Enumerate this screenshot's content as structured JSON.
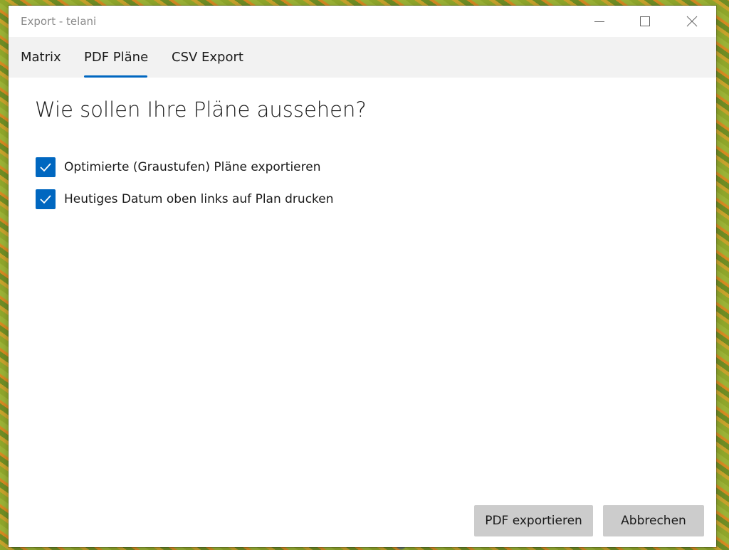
{
  "window": {
    "title": "Export - telani",
    "controls": {
      "minimize_icon": "minimize-icon",
      "maximize_icon": "maximize-icon",
      "close_icon": "close-icon"
    }
  },
  "tabs": [
    {
      "label": "Matrix",
      "selected": false
    },
    {
      "label": "PDF Pläne",
      "selected": true
    },
    {
      "label": "CSV Export",
      "selected": false
    }
  ],
  "main": {
    "heading": "Wie sollen Ihre Pläne aussehen?",
    "options": [
      {
        "label": "Optimierte (Graustufen) Pläne exportieren",
        "checked": true
      },
      {
        "label": "Heutiges Datum oben links auf Plan drucken",
        "checked": true
      }
    ]
  },
  "actions": {
    "export_label": "PDF exportieren",
    "cancel_label": "Abbrechen"
  },
  "colors": {
    "accent": "#0067c0",
    "tabbar_background": "#f2f2f2",
    "button_background": "#cccccc",
    "title_text": "#8a8a8a"
  }
}
